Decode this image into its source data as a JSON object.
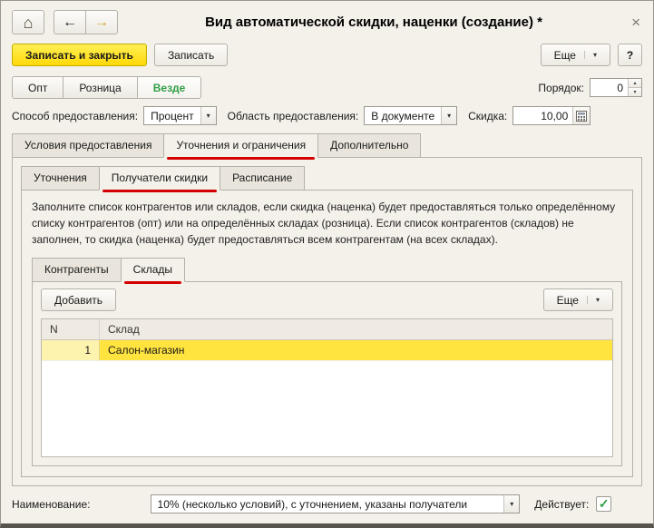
{
  "window": {
    "title": "Вид автоматической скидки, наценки (создание) *"
  },
  "icons": {
    "home": "⌂",
    "back": "←",
    "forward": "→",
    "dropdown": "▾",
    "up": "▴",
    "down": "▾",
    "close": "×",
    "check": "✓"
  },
  "toolbar": {
    "save_close": "Записать и закрыть",
    "save": "Записать",
    "more": "Еще",
    "help": "?"
  },
  "scope": {
    "options": [
      {
        "label": "Опт"
      },
      {
        "label": "Розница"
      },
      {
        "label": "Везде"
      }
    ],
    "order_label": "Порядок:",
    "order_value": "0"
  },
  "params": {
    "method_label": "Способ предоставления:",
    "method_value": "Процент",
    "area_label": "Область предоставления:",
    "area_value": "В документе",
    "discount_label": "Скидка:",
    "discount_value": "10,00"
  },
  "tabs_main": [
    {
      "label": "Условия предоставления"
    },
    {
      "label": "Уточнения и ограничения"
    },
    {
      "label": "Дополнительно"
    }
  ],
  "tabs_inner": [
    {
      "label": "Уточнения"
    },
    {
      "label": "Получатели скидки"
    },
    {
      "label": "Расписание"
    }
  ],
  "description": "Заполните список контрагентов или складов, если скидка (наценка) будет предоставляться только определённому списку контрагентов (опт) или на определённых складах (розница). Если список контрагентов (складов) не заполнен, то скидка (наценка) будет предоставляться всем контрагентам (на всех складах).",
  "tabs_lists": [
    {
      "label": "Контрагенты"
    },
    {
      "label": "Склады"
    }
  ],
  "list_toolbar": {
    "add": "Добавить",
    "more": "Еще"
  },
  "table": {
    "columns": [
      "N",
      "Склад"
    ],
    "rows": [
      {
        "n": "1",
        "sklad": "Салон-магазин"
      }
    ]
  },
  "footer": {
    "name_label": "Наименование:",
    "name_value": "10% (несколько условий), с уточнением, указаны получатели",
    "active_label": "Действует:"
  }
}
